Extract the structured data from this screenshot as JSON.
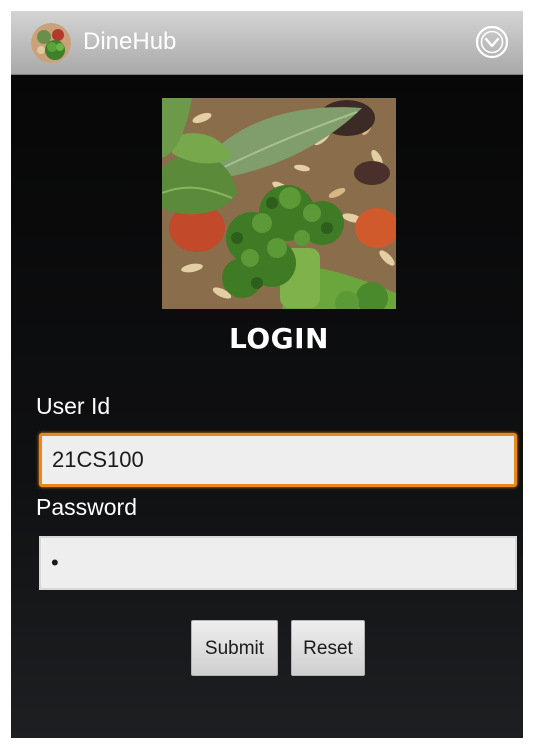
{
  "action_bar": {
    "title": "DineHub",
    "app_icon": "food-plate-icon",
    "overflow_icon": "circle-chevron-down-icon"
  },
  "login": {
    "heading": "LOGIN",
    "user_id_label": "User Id",
    "user_id_value": "21CS100",
    "password_label": "Password",
    "password_value": "•",
    "submit_label": "Submit",
    "reset_label": "Reset"
  },
  "colors": {
    "focus_border": "#e8891e",
    "background": "#121315",
    "action_bar": "#bdbdbd"
  }
}
